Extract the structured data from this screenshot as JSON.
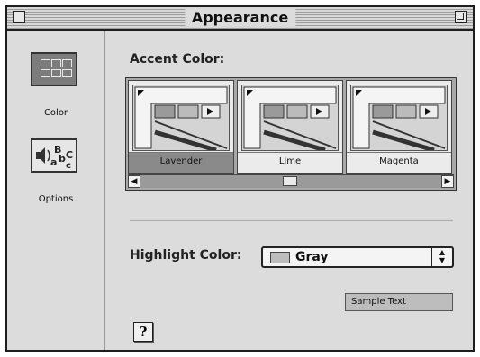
{
  "window": {
    "title": "Appearance"
  },
  "sidebar": {
    "items": [
      {
        "label": "Color",
        "icon": "color-grid-icon",
        "selected": true
      },
      {
        "label": "Options",
        "icon": "sound-letters-icon",
        "selected": false
      }
    ]
  },
  "accent": {
    "heading": "Accent Color:",
    "swatches": [
      {
        "label": "Lavender",
        "selected": true
      },
      {
        "label": "Lime",
        "selected": false
      },
      {
        "label": "Magenta",
        "selected": false
      }
    ]
  },
  "highlight": {
    "label": "Highlight Color:",
    "value": "Gray",
    "swatch_color": "#bdbdbd"
  },
  "sample": {
    "text": "Sample Text"
  },
  "help": {
    "label": "?"
  }
}
